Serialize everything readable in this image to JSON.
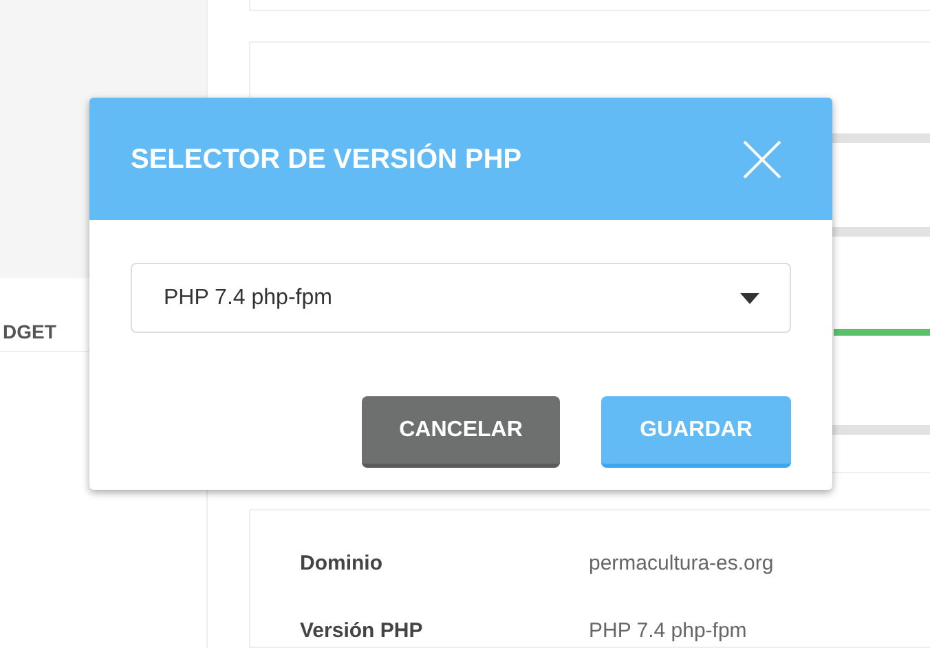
{
  "background": {
    "sidebar_tab": "DGET",
    "details": [
      {
        "label": "Dominio",
        "value": "permacultura-es.org"
      },
      {
        "label": "Versión PHP",
        "value": "PHP 7.4 php-fpm"
      }
    ]
  },
  "modal": {
    "title": "SELECTOR DE VERSIÓN PHP",
    "select": {
      "value": "PHP 7.4 php-fpm"
    },
    "buttons": [
      {
        "kind": "secondary",
        "label": "CANCELAR"
      },
      {
        "kind": "primary",
        "label": "GUARDAR"
      }
    ]
  }
}
